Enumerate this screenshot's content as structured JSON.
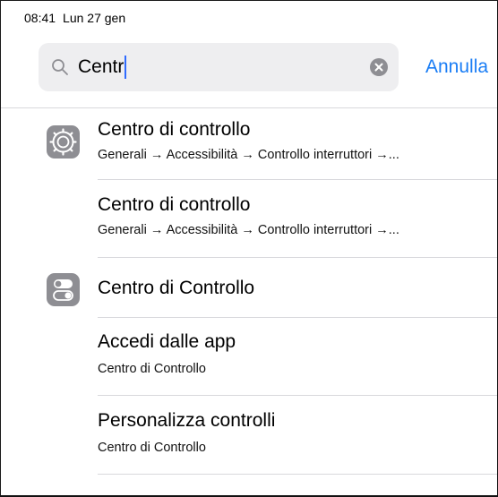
{
  "status_bar": {
    "time": "08:41",
    "date": "Lun 27 gen"
  },
  "search": {
    "query": "Centr",
    "cancel_label": "Annulla"
  },
  "results": [
    {
      "title": "Centro di controllo",
      "subtitle": "Generali → Accessibilità → Controllo interruttori →...",
      "icon": "gear-icon"
    },
    {
      "title": "Centro di controllo",
      "subtitle": "Generali → Accessibilità → Controllo interruttori →...",
      "icon": ""
    },
    {
      "title": "Centro di Controllo",
      "subtitle": "",
      "icon": "control-center-icon"
    },
    {
      "title": "Accedi dalle app",
      "subtitle": "Centro di Controllo",
      "icon": ""
    },
    {
      "title": "Personalizza controlli",
      "subtitle": "Centro di Controllo",
      "icon": ""
    }
  ],
  "colors": {
    "accent": "#1a7df5",
    "field_bg": "#eeeef0",
    "icon_bg": "#8e8e93",
    "separator": "#d8d8dc"
  }
}
